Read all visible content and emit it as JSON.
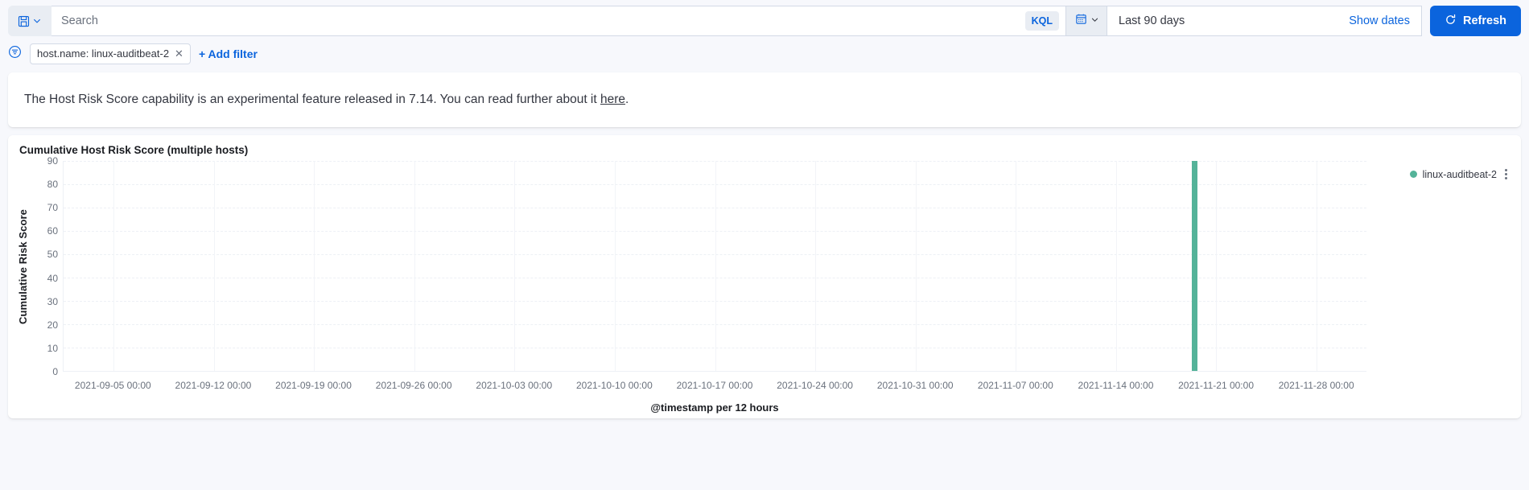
{
  "query_bar": {
    "saved_query_icon": "save-floppy-icon",
    "saved_query_chevron_icon": "chevron-down-icon",
    "search_placeholder": "Search",
    "search_value": "",
    "kql_label": "KQL",
    "calendar_icon": "calendar-icon",
    "calendar_chevron_icon": "chevron-down-icon",
    "date_range": "Last 90 days",
    "show_dates_label": "Show dates",
    "refresh_label": "Refresh",
    "refresh_icon": "refresh-icon"
  },
  "filter_bar": {
    "filter_options_icon": "filter-options-icon",
    "filters": [
      {
        "label": "host.name: linux-auditbeat-2",
        "remove_icon": "close-icon"
      }
    ],
    "add_filter_label": "+ Add filter"
  },
  "callout": {
    "text_before": "The Host Risk Score capability is an experimental feature released in 7.14. You can read further about it ",
    "link_text": "here",
    "text_after": "."
  },
  "chart_panel": {
    "title": "Cumulative Host Risk Score (multiple hosts)",
    "legend_menu_icon": "more-vertical-icon",
    "panel_menu_icon": "more-vertical-icon"
  },
  "colors": {
    "series_green": "#54B399",
    "accent_blue": "#0B64DD",
    "grid": "#EDF0F5",
    "text": "#343741",
    "muted_text": "#6A717D"
  },
  "chart_data": {
    "type": "bar",
    "title": "Cumulative Host Risk Score (multiple hosts)",
    "xlabel": "@timestamp per 12 hours",
    "ylabel": "Cumulative Risk Score",
    "grid": true,
    "legend_position": "right",
    "ylim": [
      0,
      90
    ],
    "yticks": [
      0,
      10,
      20,
      30,
      40,
      50,
      60,
      70,
      80,
      90
    ],
    "xticks": [
      "2021-09-05 00:00",
      "2021-09-12 00:00",
      "2021-09-19 00:00",
      "2021-09-26 00:00",
      "2021-10-03 00:00",
      "2021-10-10 00:00",
      "2021-10-17 00:00",
      "2021-10-24 00:00",
      "2021-10-31 00:00",
      "2021-11-07 00:00",
      "2021-11-14 00:00",
      "2021-11-21 00:00",
      "2021-11-28 00:00"
    ],
    "series": [
      {
        "name": "linux-auditbeat-2",
        "color": "#54B399",
        "points": [
          {
            "x": "2021-11-19 12:00",
            "y": 91.5
          }
        ]
      }
    ]
  }
}
